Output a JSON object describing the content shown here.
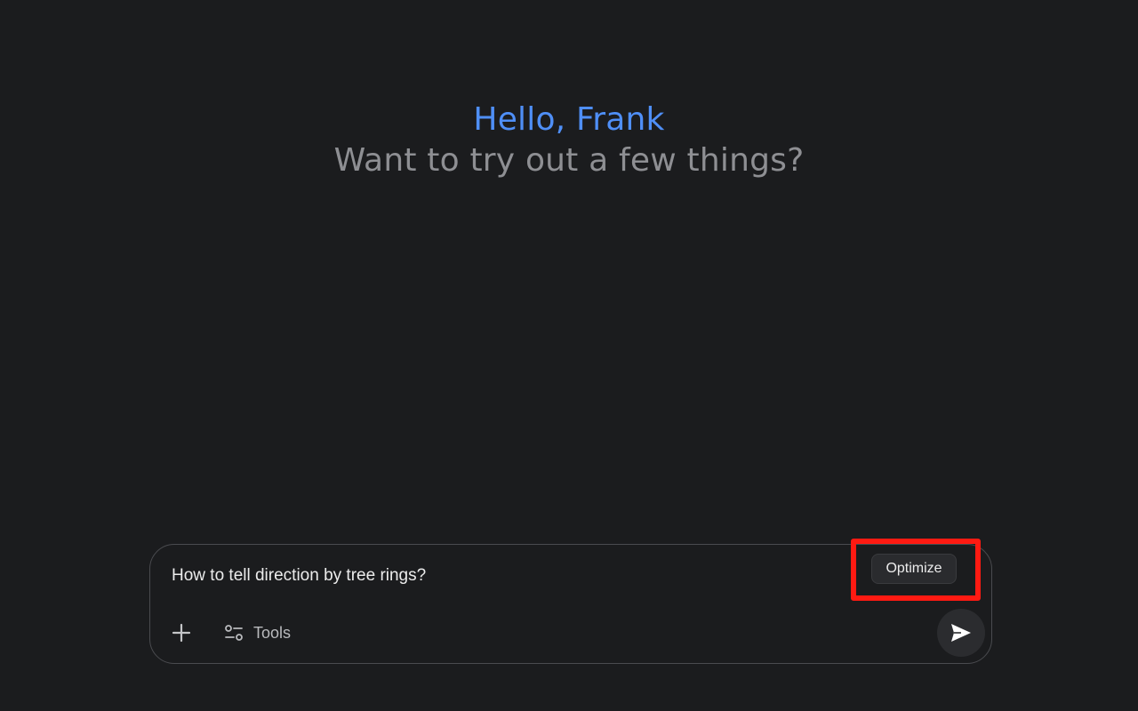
{
  "greeting": {
    "hello": "Hello, Frank",
    "subtitle": "Want to try out a few things?"
  },
  "composer": {
    "input_value": "How to tell direction by tree rings?",
    "tools_label": "Tools",
    "optimize_label": "Optimize",
    "add_icon": "plus-icon",
    "tools_icon": "sliders-icon",
    "send_icon": "send-icon"
  },
  "colors": {
    "background": "#1b1c1e",
    "hello_blue": "#4f8ff7",
    "subtitle_gray": "#8e8f93",
    "highlight_red": "#ff1a12"
  }
}
